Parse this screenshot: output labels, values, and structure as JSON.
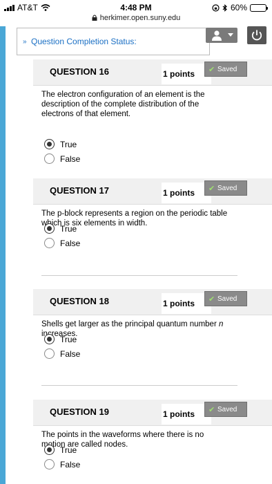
{
  "status_bar": {
    "carrier": "AT&T",
    "time": "4:48 PM",
    "battery": "60%",
    "battery_level": 0.6
  },
  "url": "herkimer.open.suny.edu",
  "completion_status": {
    "label": "Question Completion Status:"
  },
  "questions": [
    {
      "title": "QUESTION 16",
      "points": "1 points",
      "saved": "Saved",
      "text": "The electron configuration of an element is the description of the complete distribution of the electrons of that element.",
      "options": [
        "True",
        "False"
      ],
      "selected": 0
    },
    {
      "title": "QUESTION 17",
      "points": "1 points",
      "saved": "Saved",
      "text": "The p-block represents a region on the periodic table which is six elements in width.",
      "options": [
        "True",
        "False"
      ],
      "selected": 0
    },
    {
      "title": "QUESTION 18",
      "points": "1 points",
      "saved": "Saved",
      "text_before": "Shells get larger as the principal quantum number ",
      "text_italic": "n",
      "text_after": " increases.",
      "options": [
        "True",
        "False"
      ],
      "selected": 0
    },
    {
      "title": "QUESTION 19",
      "points": "1 points",
      "saved": "Saved",
      "text": "The points in the waveforms where there is no motion are called nodes.",
      "options": [
        "True",
        "False"
      ],
      "selected": 0
    }
  ]
}
